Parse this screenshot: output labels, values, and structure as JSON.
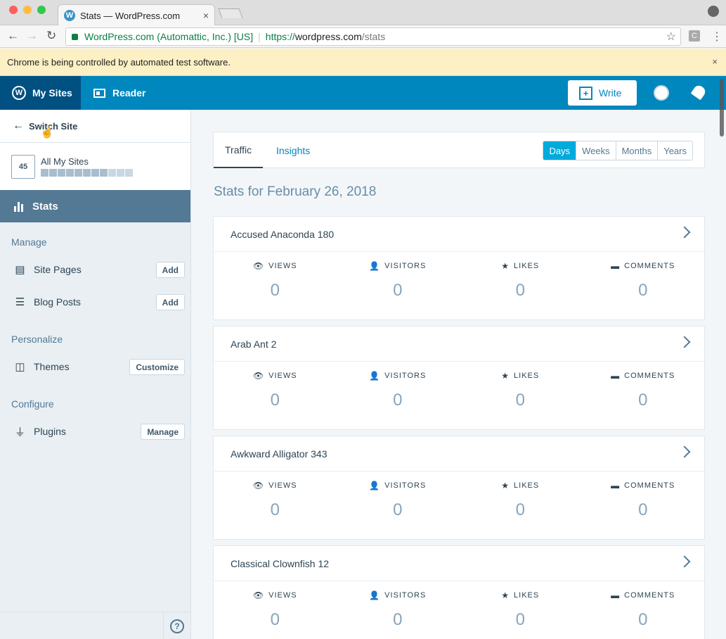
{
  "browser": {
    "tab_title": "Stats — WordPress.com",
    "tab_close": "×",
    "url_org": "WordPress.com (Automattic, Inc.) [US]",
    "url_scheme": "https://",
    "url_host": "wordpress.com",
    "url_path": "/stats",
    "infobar_text": "Chrome is being controlled by automated test software.",
    "infobar_close": "×",
    "ext_label": "C"
  },
  "masterbar": {
    "my_sites": "My Sites",
    "reader": "Reader",
    "write": "Write"
  },
  "sidebar": {
    "switch_site": "Switch Site",
    "site_count": "45",
    "site_name": "All My Sites",
    "stats": "Stats",
    "sections": {
      "manage": "Manage",
      "personalize": "Personalize",
      "configure": "Configure"
    },
    "items": [
      {
        "label": "Site Pages",
        "button": "Add"
      },
      {
        "label": "Blog Posts",
        "button": "Add"
      },
      {
        "label": "Themes",
        "button": "Customize"
      },
      {
        "label": "Plugins",
        "button": "Manage"
      }
    ],
    "help": "?"
  },
  "main": {
    "tabs": [
      {
        "label": "Traffic"
      },
      {
        "label": "Insights"
      }
    ],
    "periods": [
      "Days",
      "Weeks",
      "Months",
      "Years"
    ],
    "selected_period": "Days",
    "heading": "Stats for February 26, 2018",
    "metric_labels": {
      "views": "VIEWS",
      "visitors": "VISITORS",
      "likes": "LIKES",
      "comments": "COMMENTS"
    },
    "sites": [
      {
        "name": "Accused Anaconda 180",
        "views": "0",
        "visitors": "0",
        "likes": "0",
        "comments": "0"
      },
      {
        "name": "Arab Ant 2",
        "views": "0",
        "visitors": "0",
        "likes": "0",
        "comments": "0"
      },
      {
        "name": "Awkward Alligator 343",
        "views": "0",
        "visitors": "0",
        "likes": "0",
        "comments": "0"
      },
      {
        "name": "Classical Clownfish 12",
        "views": "0",
        "visitors": "0",
        "likes": "0",
        "comments": "0"
      }
    ]
  },
  "colors": {
    "masterbar": "#0087be",
    "masterbar_active": "#005082",
    "sidebar_selected": "#537994",
    "period_selected": "#00aadc"
  }
}
